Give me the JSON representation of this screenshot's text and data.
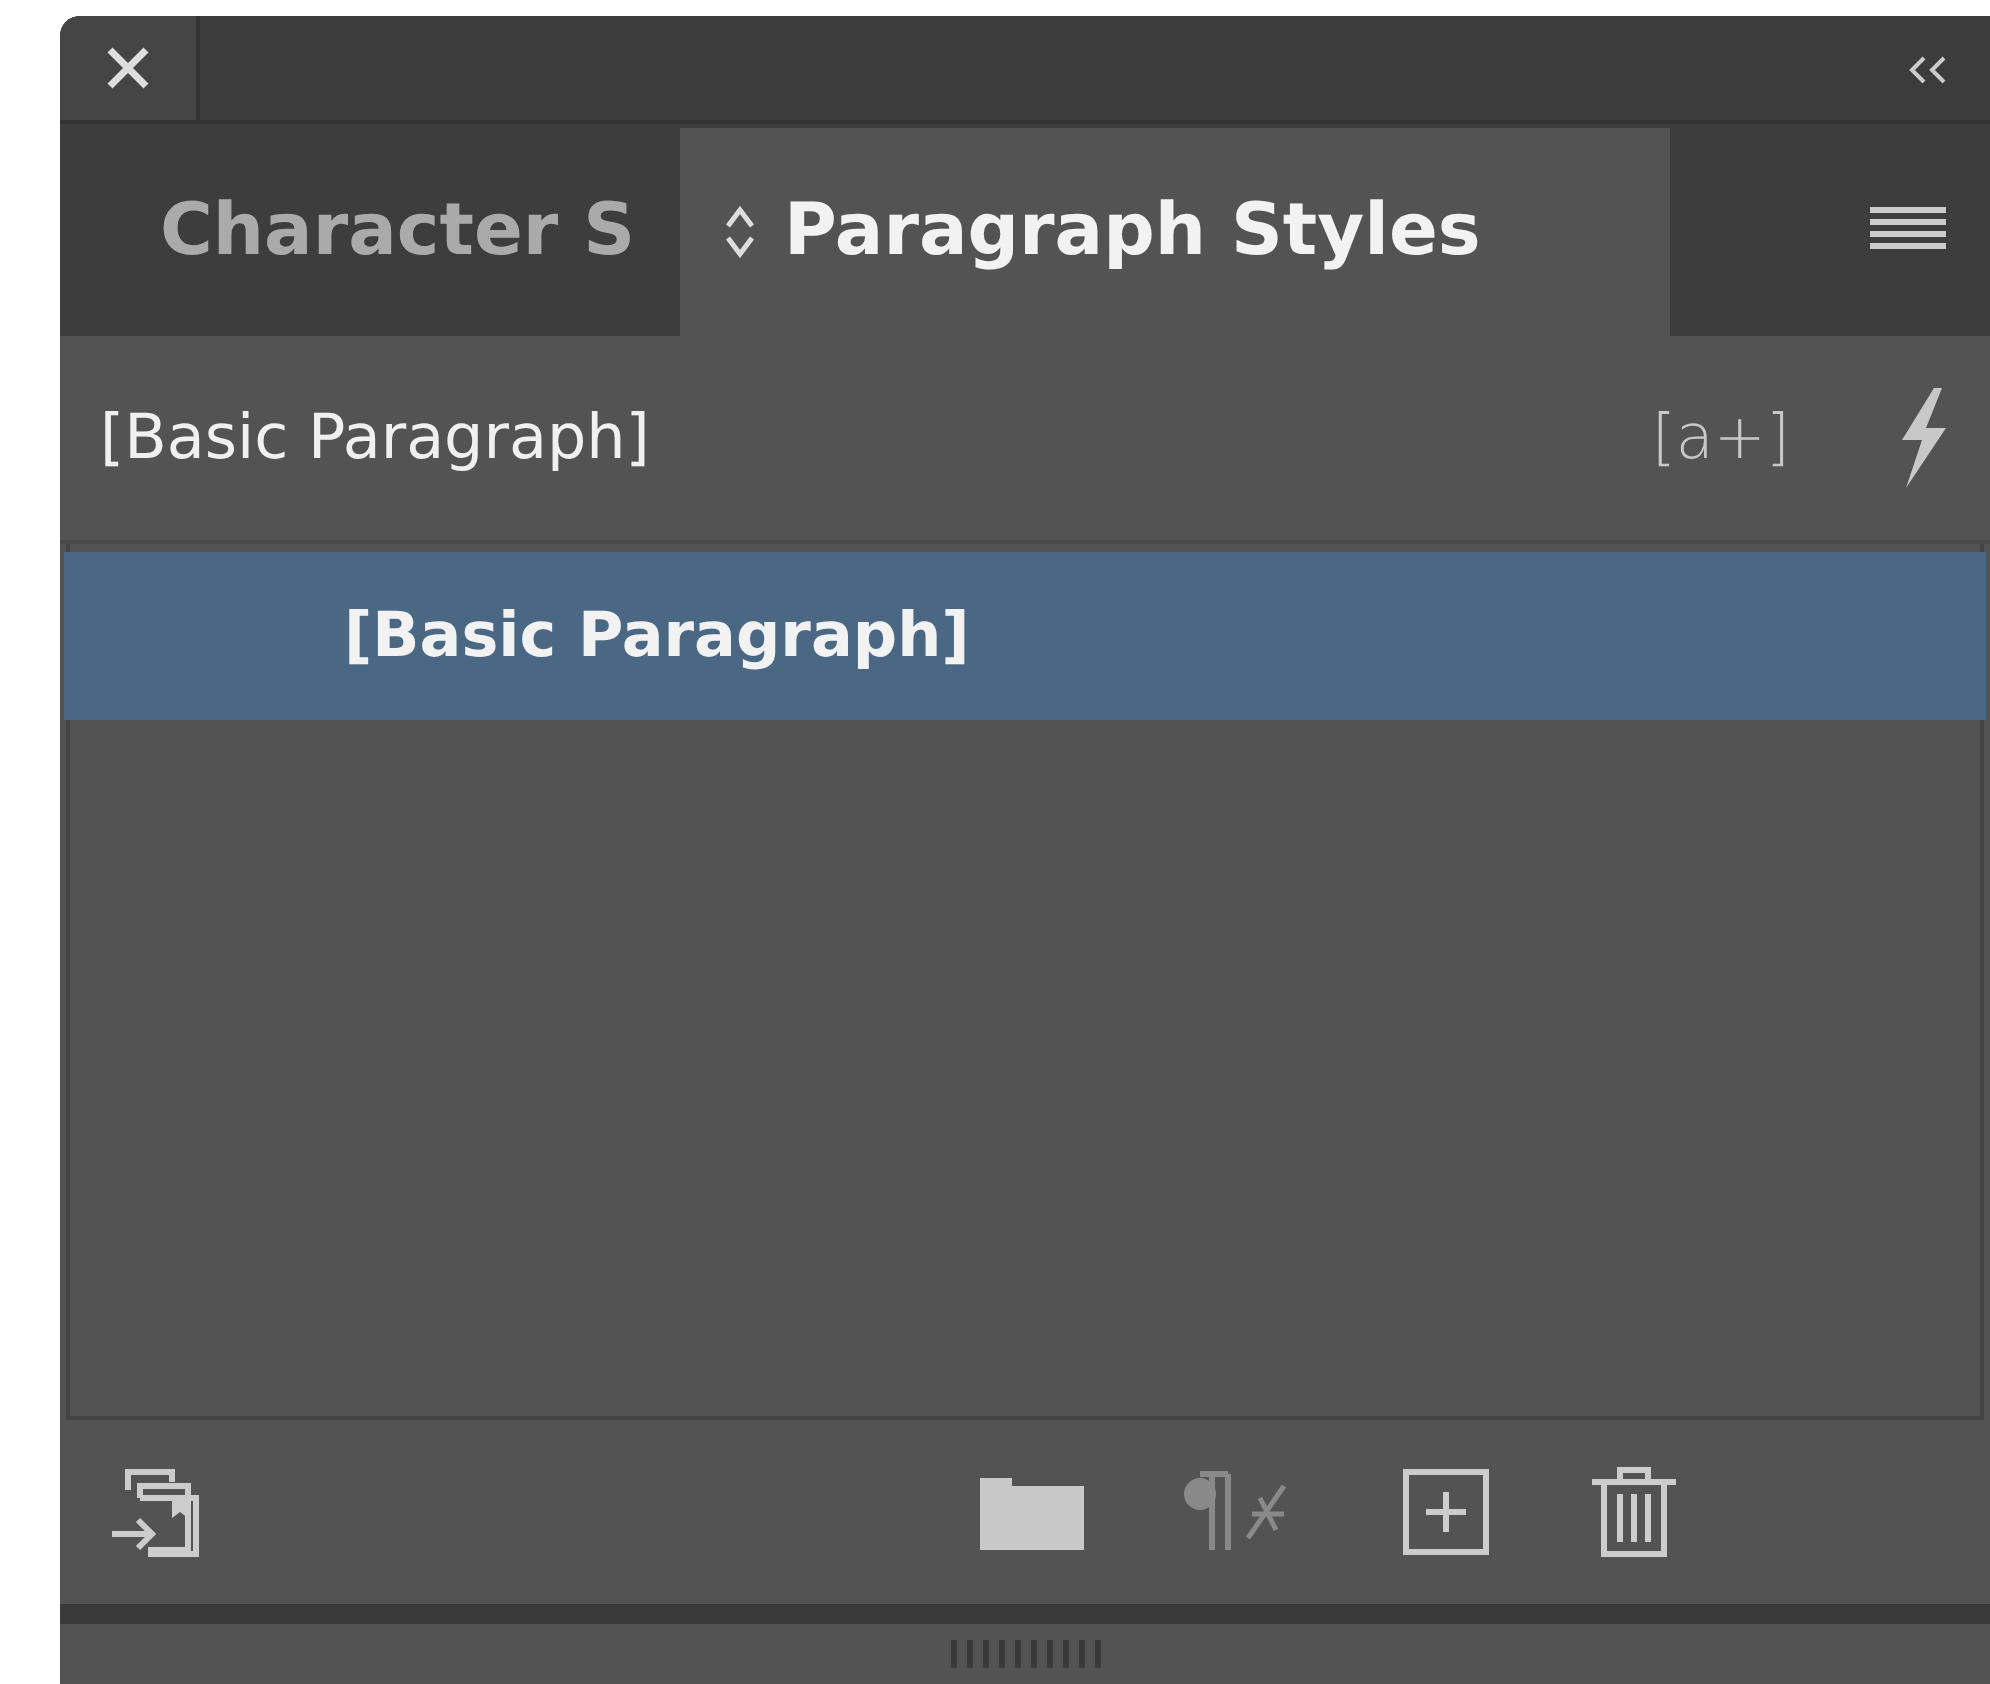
{
  "tabs": [
    {
      "label": "Character S",
      "selected": false
    },
    {
      "label": "Paragraph Styles",
      "selected": true
    }
  ],
  "current_style": "[Basic Paragraph]",
  "style_shortcut": "[a+]",
  "styles": [
    {
      "label": "[Basic Paragraph]",
      "selected": true
    }
  ],
  "footer_buttons": [
    {
      "kind": "load",
      "disabled": false
    },
    {
      "kind": "folder",
      "disabled": false
    },
    {
      "kind": "clear",
      "disabled": true
    },
    {
      "kind": "new",
      "disabled": false
    },
    {
      "kind": "delete",
      "disabled": false
    }
  ]
}
